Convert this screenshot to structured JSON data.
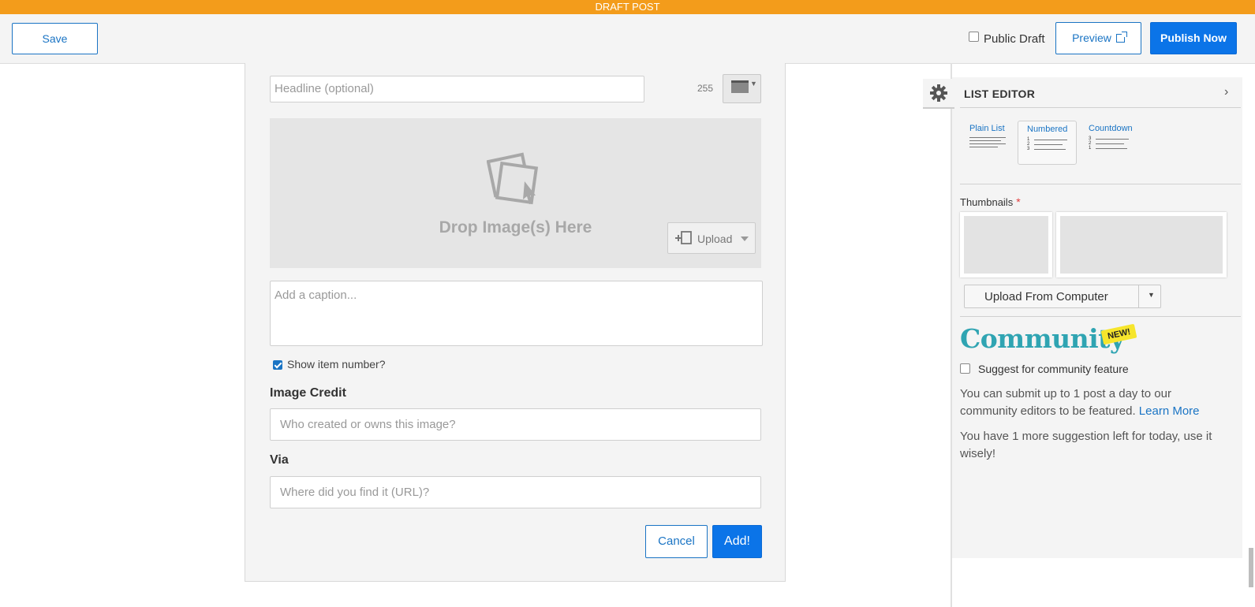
{
  "banner": {
    "text": "DRAFT POST"
  },
  "toolbar": {
    "save_label": "Save",
    "public_draft_label": "Public Draft",
    "preview_label": "Preview",
    "publish_label": "Publish Now"
  },
  "editor": {
    "headline_placeholder": "Headline (optional)",
    "char_count": "255",
    "drop_text": "Drop Image(s) Here",
    "upload_label": "Upload",
    "caption_placeholder": "Add a caption...",
    "show_number_label": "Show item number?",
    "image_credit_label": "Image Credit",
    "image_credit_placeholder": "Who created or owns this image?",
    "via_label": "Via",
    "via_placeholder": "Where did you find it (URL)?",
    "cancel_label": "Cancel",
    "add_label": "Add!"
  },
  "sidebar": {
    "title": "LIST EDITOR",
    "list_types": [
      {
        "label": "Plain List"
      },
      {
        "label": "Numbered",
        "active": true
      },
      {
        "label": "Countdown"
      }
    ],
    "thumbnails_label": "Thumbnails",
    "required_mark": "*",
    "upload_computer_label": "Upload From Computer",
    "community_logo": "Community",
    "new_badge": "NEW!",
    "suggest_label": "Suggest for community feature",
    "para1": "You can submit up to 1 post a day to our community editors to be featured.",
    "learn_more": "Learn More",
    "para2": "You have 1 more suggestion left for today, use it wisely!"
  },
  "colors": {
    "banner": "#f39c1b",
    "accent": "#0b74e8",
    "community": "#2fa4b2",
    "badge": "#f6e52c"
  }
}
